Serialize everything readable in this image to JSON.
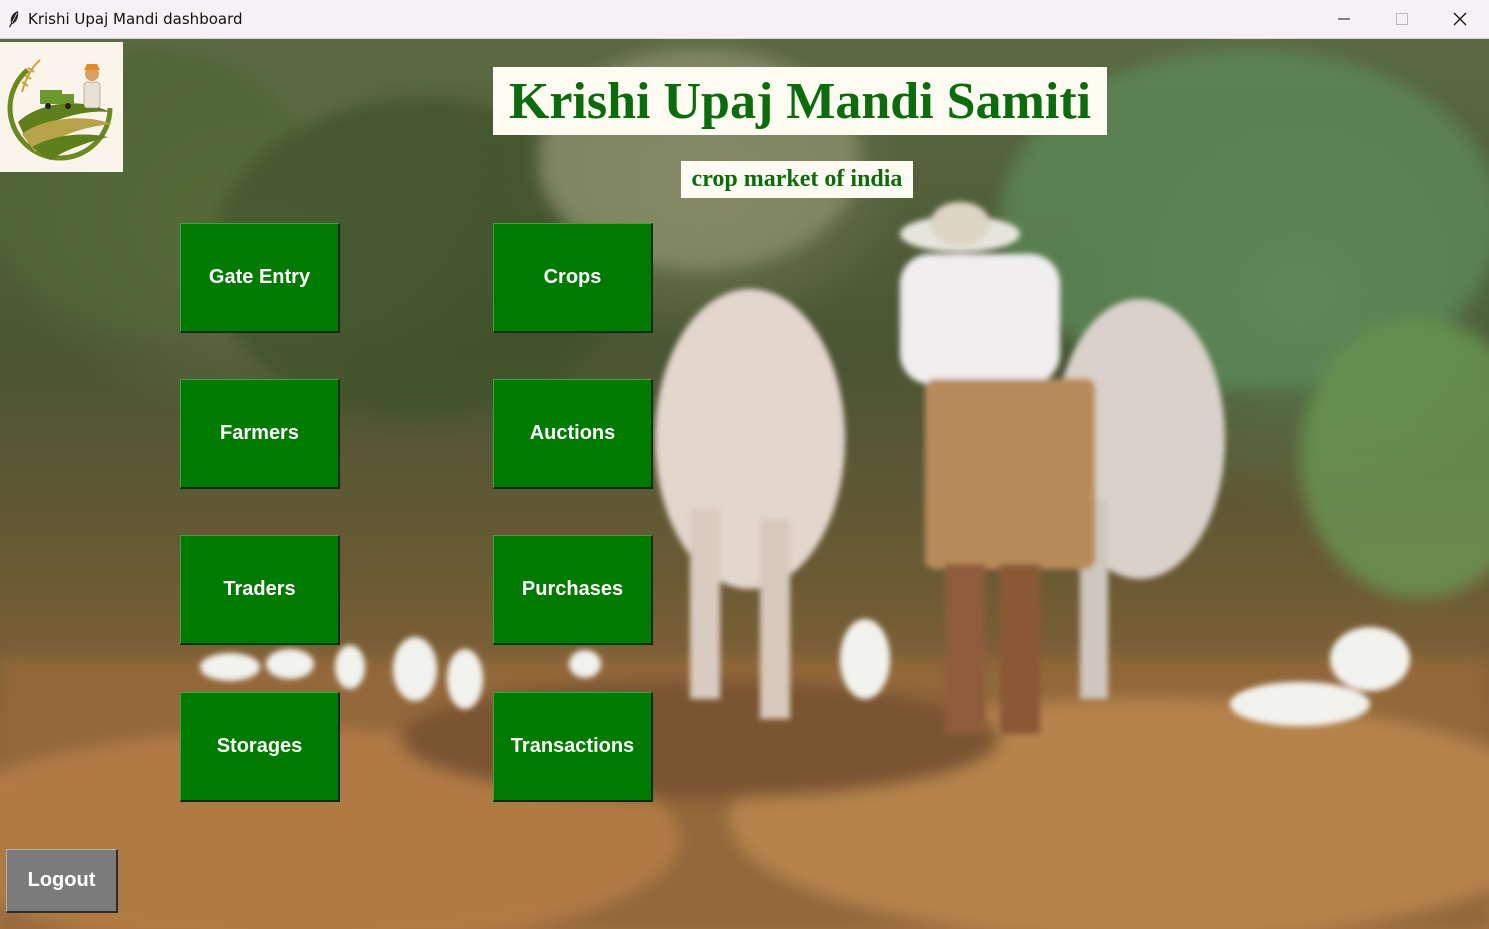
{
  "window": {
    "title": "Krishi Upaj Mandi dashboard"
  },
  "header": {
    "title": "Krishi Upaj Mandi Samiti",
    "subtitle": "crop market of india"
  },
  "buttons": {
    "gate_entry": "Gate Entry",
    "crops": "Crops",
    "farmers": "Farmers",
    "auctions": "Auctions",
    "traders": "Traders",
    "purchases": "Purchases",
    "storages": "Storages",
    "transactions": "Transactions",
    "logout": "Logout"
  },
  "colors": {
    "button_green": "#007a00",
    "title_text_green": "#0c6b0c",
    "logout_gray": "#7b7b7b"
  },
  "icons": {
    "app": "feather-icon",
    "logo": "farm-logo-icon",
    "minimize": "minimize-icon",
    "maximize": "maximize-icon",
    "close": "close-icon"
  }
}
